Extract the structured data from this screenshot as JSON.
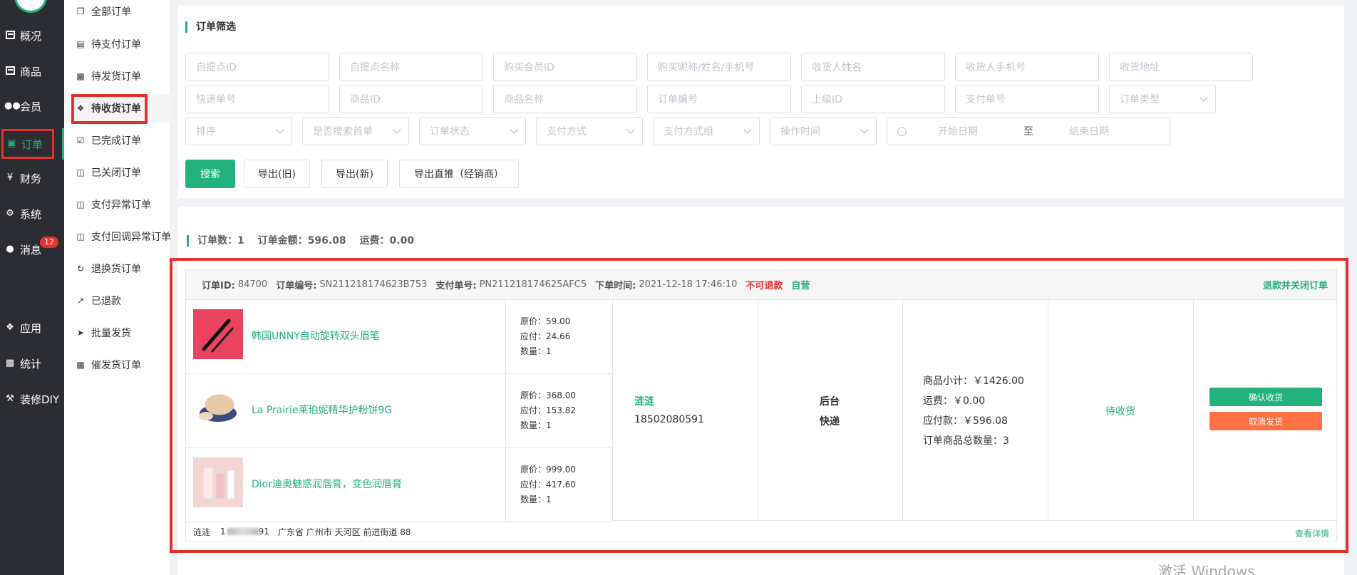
{
  "sidebar": {
    "items": [
      {
        "label": "概况",
        "icon": "dashboard-icon"
      },
      {
        "label": "商品",
        "icon": "product-icon"
      },
      {
        "label": "会员",
        "icon": "members-icon"
      },
      {
        "label": "订单",
        "icon": "cart-icon"
      },
      {
        "label": "财务",
        "icon": "yen-icon"
      },
      {
        "label": "系统",
        "icon": "gears-icon"
      },
      {
        "label": "消息",
        "icon": "chat-icon",
        "badge": "12"
      },
      {
        "label": "应用",
        "icon": "apps-icon"
      },
      {
        "label": "统计",
        "icon": "bar-chart-icon"
      },
      {
        "label": "装修DIY",
        "icon": "hammer-icon"
      }
    ]
  },
  "submenu": {
    "items": [
      {
        "label": "全部订单",
        "icon": "copy-icon"
      },
      {
        "label": "待支付订单",
        "icon": "card-icon"
      },
      {
        "label": "待发货订单",
        "icon": "truck-icon"
      },
      {
        "label": "待收货订单",
        "icon": "box-icon"
      },
      {
        "label": "已完成订单",
        "icon": "check-square-icon"
      },
      {
        "label": "已关闭订单",
        "icon": "trash-icon"
      },
      {
        "label": "支付异常订单",
        "icon": "trash-icon"
      },
      {
        "label": "支付回调异常订单",
        "icon": "trash-icon"
      },
      {
        "label": "退换货订单",
        "icon": "refresh-icon"
      },
      {
        "label": "已退款",
        "icon": "share-icon"
      },
      {
        "label": "批量发货",
        "icon": "send-icon"
      },
      {
        "label": "催发货订单",
        "icon": "truck-icon"
      }
    ]
  },
  "filter": {
    "title": "订单筛选",
    "row1": [
      "自提点ID",
      "自提点名称",
      "购买会员ID",
      "购买昵称/姓名/手机号",
      "收货人姓名",
      "收货人手机号",
      "收货地址"
    ],
    "row2": [
      "快递单号",
      "商品ID",
      "商品名称",
      "订单编号",
      "上级ID",
      "支付单号"
    ],
    "order_type": "订单类型",
    "row3": [
      "排序",
      "是否搜索首单",
      "订单状态",
      "支付方式",
      "支付方式组",
      "操作时间"
    ],
    "start_date": "开始日期",
    "date_sep": "至",
    "end_date": "结束日期",
    "search_label": "搜索",
    "export_old_label": "导出(旧)",
    "export_new_label": "导出(新)",
    "export_direct_label": "导出直推（经销商）"
  },
  "summary": {
    "count_label": "订单数：",
    "count": "1",
    "amount_label": "订单金额：",
    "amount": "596.08",
    "freight_label": "运费：",
    "freight": "0.00"
  },
  "order": {
    "id_label": "订单ID:",
    "id": "84700",
    "no_label": "订单编号:",
    "no": "SN211218174623B753",
    "pay_no_label": "支付单号:",
    "pay_no": "PN211218174625AFC5",
    "time_label": "下单时间:",
    "time": "2021-12-18 17:46:10",
    "no_refund": "不可退款",
    "self_run": "自营",
    "refund_close_label": "退款并关闭订单",
    "products": [
      {
        "name": "韩国UNNY自动旋转双头眉笔",
        "orig": "原价：59.00",
        "due": "应付：24.66",
        "qty": "数量：1"
      },
      {
        "name": "La Prairie莱珀妮精华护粉饼9G",
        "orig": "原价：368.00",
        "due": "应付：153.82",
        "qty": "数量：1"
      },
      {
        "name": "Dior迪奥魅惑润唇膏，变色润唇膏",
        "orig": "原价：999.00",
        "due": "应付：417.60",
        "qty": "数量：1"
      }
    ],
    "buyer_name": "涟涟",
    "buyer_phone": "18502080591",
    "source": "后台",
    "delivery": "快递",
    "subtotal": "商品小计：￥1426.00",
    "freight": "运费：￥0.00",
    "payable": "应付款：￥596.08",
    "total_qty": "订单商品总数量：3",
    "status": "待收货",
    "confirm_label": "确认收货",
    "cancel_ship_label": "取消发货",
    "foot_name": "涟涟",
    "foot_phone_prefix": "1",
    "foot_phone_suffix": "91",
    "foot_address": "广东省 广州市 天河区 前进街道 88",
    "detail_label": "查看详情"
  },
  "watermark": "激活 Windows",
  "colors": {
    "accent": "#23b27c",
    "danger": "#e4312b",
    "warning": "#ff7043",
    "sidebar": "#2b2d33"
  }
}
